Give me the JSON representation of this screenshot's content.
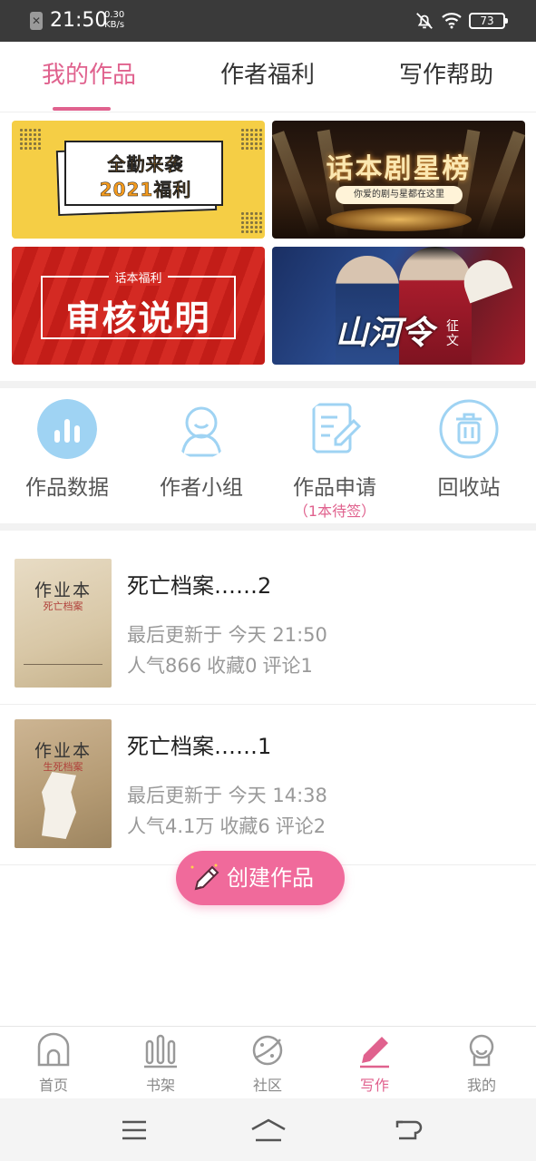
{
  "status_bar": {
    "time": "21:50",
    "speed_value": "0.30",
    "speed_unit": "KB/s",
    "battery": "73"
  },
  "tabs": [
    {
      "label": "我的作品",
      "active": true
    },
    {
      "label": "作者福利",
      "active": false
    },
    {
      "label": "写作帮助",
      "active": false
    }
  ],
  "banners": {
    "b1": {
      "line1": "全勤来袭",
      "line2": "2021福利"
    },
    "b2": {
      "title": "话本剧星榜",
      "subtitle": "你爱的剧与星都在这里"
    },
    "b3": {
      "subtitle": "话本福利",
      "title": "审核说明"
    },
    "b4": {
      "title": "山河令",
      "tag": "征文"
    }
  },
  "quick_actions": [
    {
      "label": "作品数据",
      "icon": "bar-chart-icon"
    },
    {
      "label": "作者小组",
      "icon": "group-avatar-icon"
    },
    {
      "label": "作品申请",
      "icon": "edit-document-icon",
      "sub": "（1本待签）"
    },
    {
      "label": "回收站",
      "icon": "trash-icon"
    }
  ],
  "works": [
    {
      "title": "死亡档案……2",
      "updated": "最后更新于 今天 21:50",
      "popularity": "人气866",
      "favorites": "收藏0",
      "comments": "评论1",
      "cover_title": "作业本",
      "cover_sub": "死亡档案"
    },
    {
      "title": "死亡档案……1",
      "updated": "最后更新于 今天 14:38",
      "popularity": "人气4.1万",
      "favorites": "收藏6",
      "comments": "评论2",
      "cover_title": "作业本",
      "cover_sub": "生死档案"
    }
  ],
  "fab": {
    "label": "创建作品"
  },
  "bottom_nav": [
    {
      "label": "首页",
      "icon": "home-icon",
      "active": false
    },
    {
      "label": "书架",
      "icon": "bookshelf-icon",
      "active": false
    },
    {
      "label": "社区",
      "icon": "planet-icon",
      "active": false
    },
    {
      "label": "写作",
      "icon": "pen-icon",
      "active": true
    },
    {
      "label": "我的",
      "icon": "profile-icon",
      "active": false
    }
  ],
  "colors": {
    "accent": "#e0628e",
    "fab": "#f06a9b",
    "status_bar": "#3a3a3a"
  }
}
